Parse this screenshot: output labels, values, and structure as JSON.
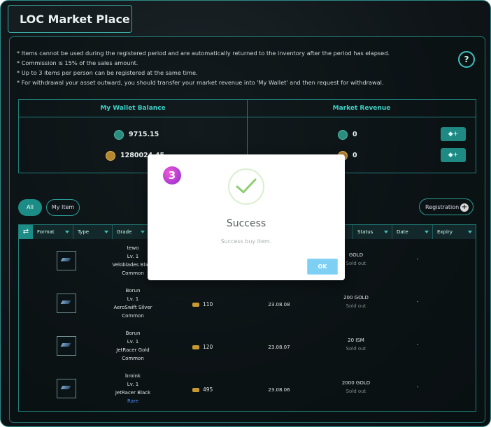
{
  "title": "LOC Market Place",
  "notes": [
    "* Items cannot be used during the registered period and are automatically returned to the inventory after the period has elapsed.",
    "* Commission is 15% of the sales amount.",
    "* Up to 3 items per person can be registered at the same time.",
    "* For withdrawal your asset outward, you should transfer your market revenue into 'My Wallet' and then request for withdrawal."
  ],
  "help_label": "?",
  "wallet": {
    "balance_header": "My Wallet Balance",
    "revenue_header": "Market Revenue",
    "balance_gem": "9715.15",
    "balance_gold": "1280024.45",
    "revenue_gem": "0",
    "revenue_gold": "0",
    "add_label": "◆+"
  },
  "filters": {
    "all": "All",
    "my_item": "My Item",
    "registration": "Registration",
    "plus": "+"
  },
  "table": {
    "headers": {
      "format": "Format",
      "type": "Type",
      "grade": "Grade",
      "status": "Status",
      "date": "Date",
      "expiry": "Expiry"
    },
    "rows": [
      {
        "seller": "tewo",
        "level": "Lv. 1",
        "item": "Veloblades Black",
        "grade": "Common",
        "price": "",
        "date": "",
        "cost": "GOLD",
        "status": "Sold out",
        "expiry": "-"
      },
      {
        "seller": "Borun",
        "level": "Lv. 1",
        "item": "AeroSwift Silver",
        "grade": "Common",
        "price": "110",
        "date": "23.08.08",
        "cost": "200 GOLD",
        "status": "Sold out",
        "expiry": "-"
      },
      {
        "seller": "Borun",
        "level": "Lv. 1",
        "item": "JetRacer Gold",
        "grade": "Common",
        "price": "120",
        "date": "23.08.07",
        "cost": "20 ISM",
        "status": "Sold out",
        "expiry": "-"
      },
      {
        "seller": "broink",
        "level": "Lv. 1",
        "item": "JetRacer Black",
        "grade": "Rare",
        "price": "495",
        "date": "23.08.06",
        "cost": "2000 GOLD",
        "status": "Sold out",
        "expiry": "-"
      }
    ]
  },
  "modal": {
    "step": "3",
    "title": "Success",
    "message": "Success buy item.",
    "ok": "OK"
  }
}
